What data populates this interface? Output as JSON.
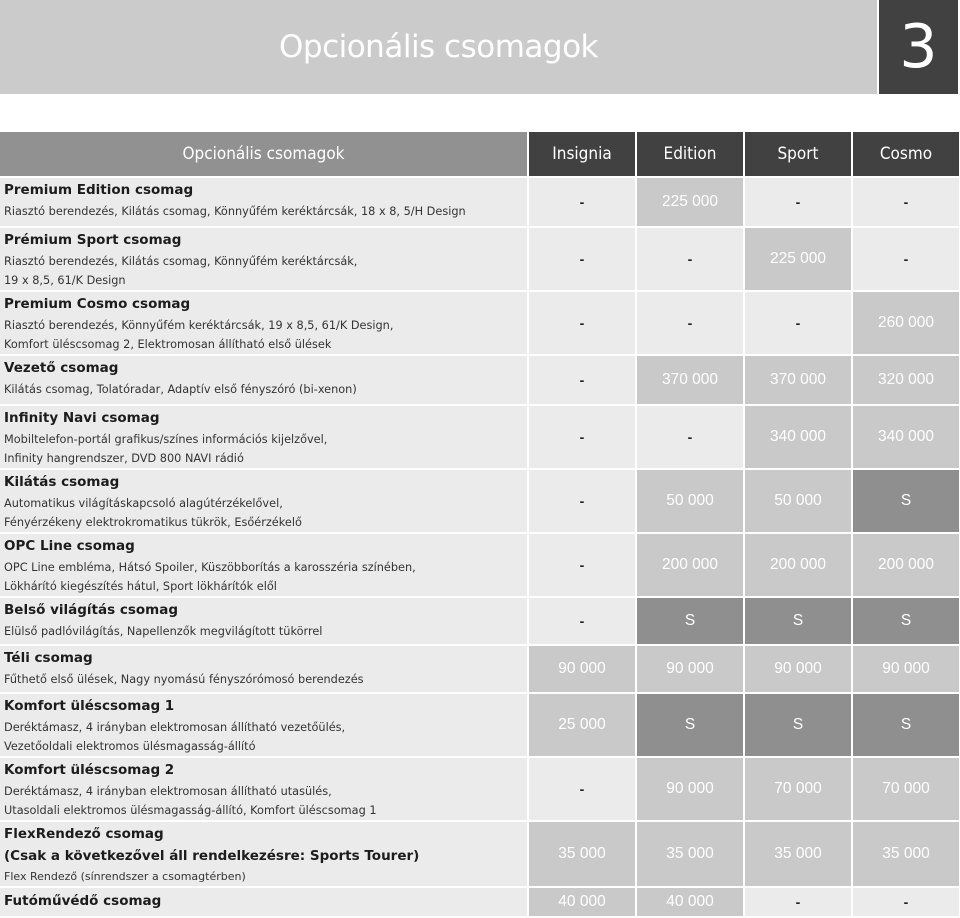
{
  "page": {
    "title": "Opcionális csomagok",
    "chapter_number": "3"
  },
  "table": {
    "header": {
      "name_column": "Opcionális csomagok",
      "columns": [
        "Insignia",
        "Edition",
        "Sport",
        "Cosmo"
      ]
    },
    "legend": {
      "dash": "-",
      "standard": "S"
    },
    "colors": {
      "unavailable_bg": "#ebebeb",
      "price_bg": "#c9c9c9",
      "standard_bg": "#8f8f8f",
      "header_dark": "#414141",
      "header_gray": "#919191",
      "title_bg": "#cbcbcb"
    },
    "rows": [
      {
        "name": "Premium Edition csomag",
        "desc": [
          "Riasztó berendezés, Kilátás csomag, Könnyűfém keréktárcsák, 18 x 8, 5/H Design"
        ],
        "values": [
          "-",
          "225 000",
          "-",
          "-"
        ]
      },
      {
        "name": "Prémium Sport csomag",
        "desc": [
          "Riasztó berendezés, Kilátás csomag, Könnyűfém keréktárcsák,",
          "19 x 8,5, 61/K Design"
        ],
        "values": [
          "-",
          "-",
          "225 000",
          "-"
        ]
      },
      {
        "name": "Premium Cosmo csomag",
        "desc": [
          "Riasztó berendezés, Könnyűfém keréktárcsák, 19 x 8,5, 61/K Design,",
          "Komfort üléscsomag 2, Elektromosan állítható első ülések"
        ],
        "values": [
          "-",
          "-",
          "-",
          "260 000"
        ]
      },
      {
        "name": "Vezető csomag",
        "desc": [
          "Kilátás csomag, Tolatóradar, Adaptív első fényszóró (bi-xenon)"
        ],
        "values": [
          "-",
          "370 000",
          "370 000",
          "320 000"
        ]
      },
      {
        "name": "Infinity Navi csomag",
        "desc": [
          "Mobiltelefon-portál grafikus/színes információs kijelzővel,",
          "Infinity hangrendszer, DVD 800 NAVI rádió"
        ],
        "values": [
          "-",
          "-",
          "340 000",
          "340 000"
        ]
      },
      {
        "name": "Kilátás csomag",
        "desc": [
          "Automatikus világításkapcsoló alagútérzékelővel,",
          "Fényérzékeny elektrokromatikus tükrök, Esőérzékelő"
        ],
        "values": [
          "-",
          "50 000",
          "50 000",
          "S"
        ]
      },
      {
        "name": "OPC Line csomag",
        "desc": [
          "OPC Line embléma, Hátsó Spoiler, Küszöbborítás a karosszéria színében,",
          "Lökhárító kiegészítés hátul, Sport lökhárítók elől"
        ],
        "values": [
          "-",
          "200 000",
          "200 000",
          "200 000"
        ]
      },
      {
        "name": "Belső világítás csomag",
        "desc": [
          "Elülső padlóvilágítás, Napellenzők megvilágított tükörrel"
        ],
        "values": [
          "-",
          "S",
          "S",
          "S"
        ]
      },
      {
        "name": "Téli csomag",
        "desc": [
          "Fűthető első ülések, Nagy nyomású fényszórómosó berendezés"
        ],
        "values": [
          "90 000",
          "90 000",
          "90 000",
          "90 000"
        ]
      },
      {
        "name": "Komfort üléscsomag 1",
        "desc": [
          "Deréktámasz, 4 irányban elektromosan állítható vezetőülés,",
          "Vezetőoldali elektromos ülésmagasság-állító"
        ],
        "values": [
          "25 000",
          "S",
          "S",
          "S"
        ]
      },
      {
        "name": "Komfort üléscsomag 2",
        "desc": [
          "Deréktámasz, 4 irányban elektromosan állítható utasülés,",
          "Utasoldali elektromos ülésmagasság-állító, Komfort üléscsomag 1"
        ],
        "values": [
          "-",
          "90 000",
          "70 000",
          "70 000"
        ]
      },
      {
        "name": "FlexRendező csomag",
        "name2": "(Csak a következővel áll rendelkezésre: Sports Tourer)",
        "desc": [
          "Flex Rendező (sínrendszer a csomagtérben)"
        ],
        "values": [
          "35 000",
          "35 000",
          "35 000",
          "35 000"
        ]
      },
      {
        "name": "Futóművédő csomag",
        "desc": [],
        "values": [
          "40 000",
          "40 000",
          "-",
          "-"
        ]
      }
    ]
  }
}
